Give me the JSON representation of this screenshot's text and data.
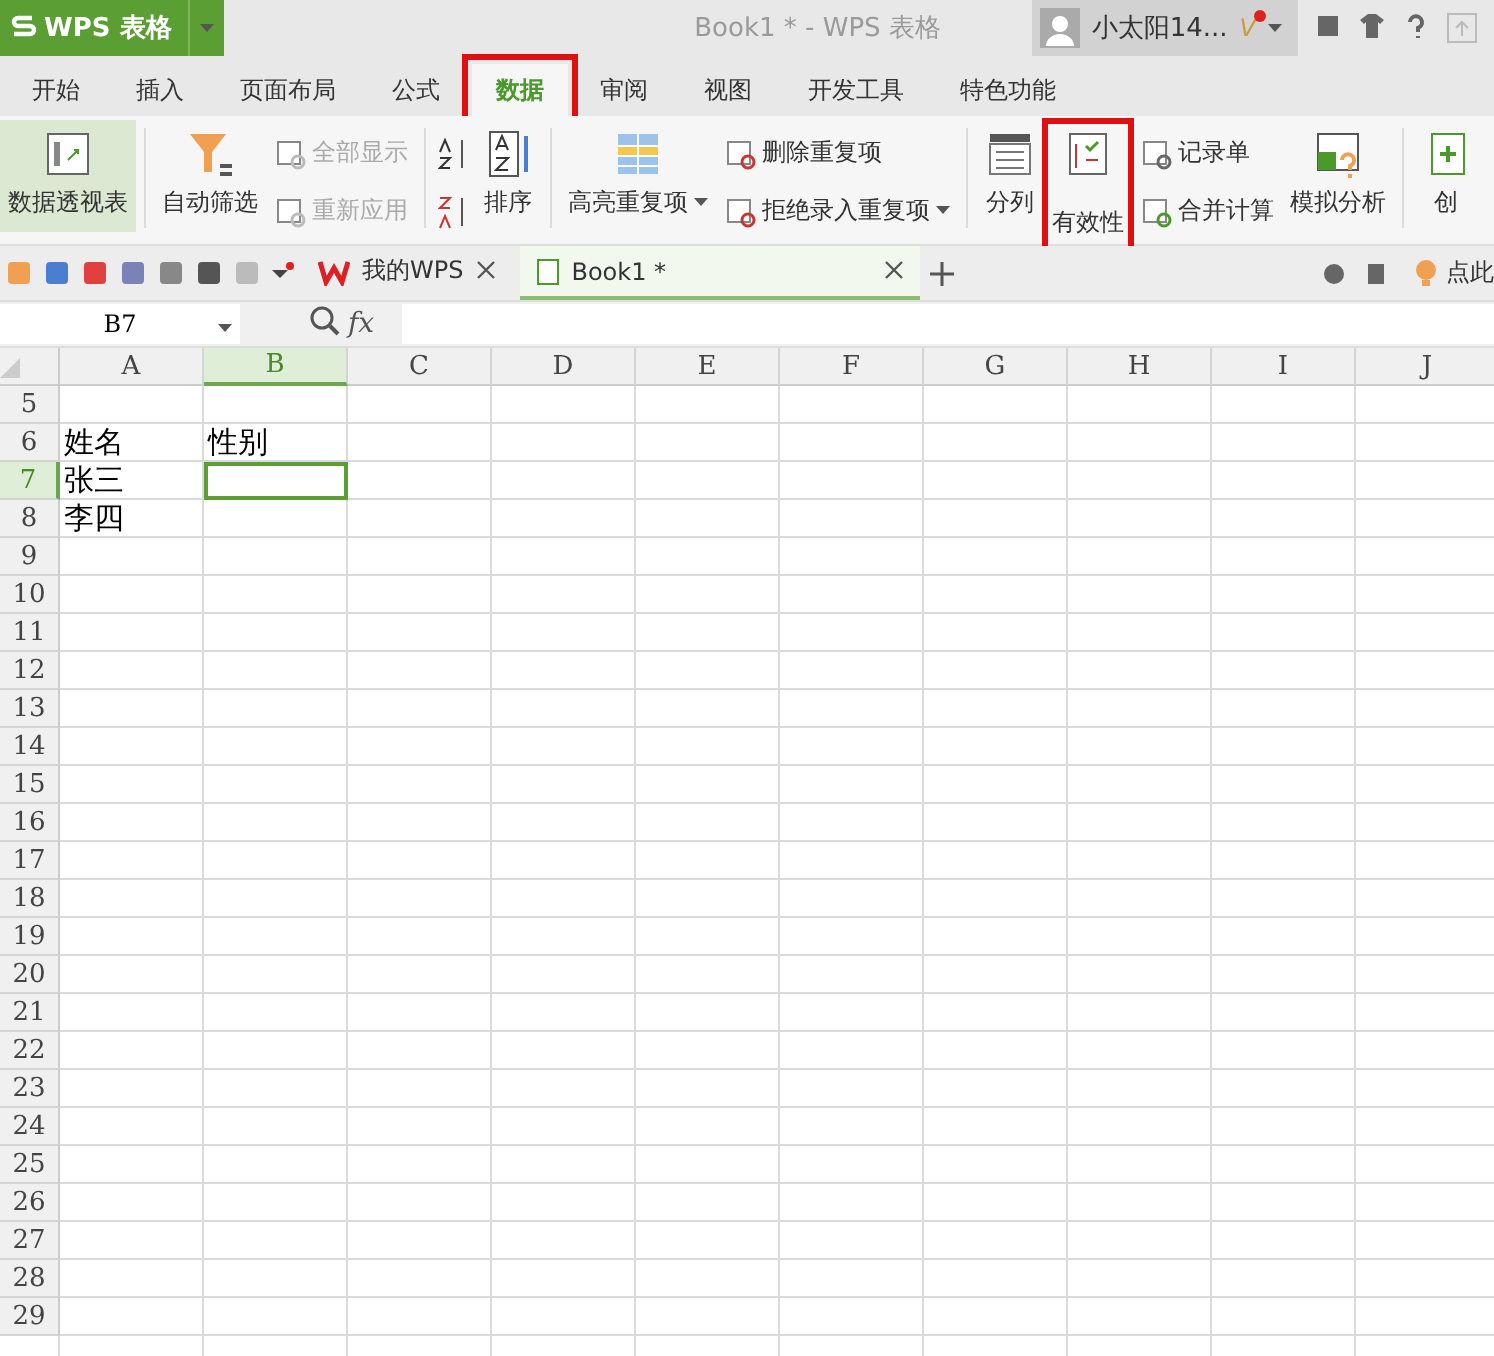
{
  "app_menu": {
    "label": "WPS 表格"
  },
  "title": "Book1 * - WPS 表格",
  "user": {
    "name": "小太阳14...",
    "badge": "V"
  },
  "tabs": [
    {
      "label": "开始",
      "selected": false,
      "highlighted": false
    },
    {
      "label": "插入",
      "selected": false,
      "highlighted": false
    },
    {
      "label": "页面布局",
      "selected": false,
      "highlighted": false
    },
    {
      "label": "公式",
      "selected": false,
      "highlighted": false
    },
    {
      "label": "数据",
      "selected": true,
      "highlighted": true
    },
    {
      "label": "审阅",
      "selected": false,
      "highlighted": false
    },
    {
      "label": "视图",
      "selected": false,
      "highlighted": false
    },
    {
      "label": "开发工具",
      "selected": false,
      "highlighted": false
    },
    {
      "label": "特色功能",
      "selected": false,
      "highlighted": false
    }
  ],
  "ribbon": [
    {
      "kind": "large",
      "label": "数据透视表",
      "pressed": true,
      "highlighted": false,
      "dropdown": false
    },
    {
      "kind": "sep"
    },
    {
      "kind": "large",
      "label": "自动筛选",
      "pressed": false,
      "highlighted": false,
      "dropdown": false
    },
    {
      "kind": "stack",
      "items": [
        {
          "label": "全部显示",
          "disabled": true,
          "dropdown": false
        },
        {
          "label": "重新应用",
          "disabled": true,
          "dropdown": false
        }
      ]
    },
    {
      "kind": "sep"
    },
    {
      "kind": "sort"
    },
    {
      "kind": "large",
      "label": "排序",
      "pressed": false,
      "highlighted": false,
      "dropdown": false
    },
    {
      "kind": "sep"
    },
    {
      "kind": "large",
      "label": "高亮重复项",
      "pressed": false,
      "highlighted": false,
      "dropdown": true
    },
    {
      "kind": "stack",
      "items": [
        {
          "label": "删除重复项",
          "disabled": false,
          "dropdown": false
        },
        {
          "label": "拒绝录入重复项",
          "disabled": false,
          "dropdown": true
        }
      ]
    },
    {
      "kind": "sep"
    },
    {
      "kind": "large",
      "label": "分列",
      "pressed": false,
      "highlighted": false,
      "dropdown": false
    },
    {
      "kind": "large",
      "label": "有效性",
      "pressed": false,
      "highlighted": true,
      "dropdown": false
    },
    {
      "kind": "stack",
      "items": [
        {
          "label": "记录单",
          "disabled": false,
          "dropdown": false
        },
        {
          "label": "合并计算",
          "disabled": false,
          "dropdown": false
        }
      ]
    },
    {
      "kind": "large",
      "label": "模拟分析",
      "pressed": false,
      "highlighted": false,
      "dropdown": false
    },
    {
      "kind": "sep"
    },
    {
      "kind": "large",
      "label": "创",
      "pressed": false,
      "highlighted": false,
      "dropdown": false
    }
  ],
  "doc_tabs": [
    {
      "label": "我的WPS",
      "selected": false
    },
    {
      "label": "Book1 *",
      "selected": true
    }
  ],
  "tip": "点此",
  "name_box": "B7",
  "function_label": "fx",
  "columns": [
    {
      "label": "A",
      "selected": false
    },
    {
      "label": "B",
      "selected": true
    },
    {
      "label": "C",
      "selected": false
    },
    {
      "label": "D",
      "selected": false
    },
    {
      "label": "E",
      "selected": false
    },
    {
      "label": "F",
      "selected": false
    },
    {
      "label": "G",
      "selected": false
    },
    {
      "label": "H",
      "selected": false
    },
    {
      "label": "I",
      "selected": false
    },
    {
      "label": "J",
      "selected": false
    }
  ],
  "rows": [
    {
      "number": "5",
      "selected": false
    },
    {
      "number": "6",
      "selected": false,
      "cells": {
        "A": "姓名",
        "B": "性别"
      }
    },
    {
      "number": "7",
      "selected": true,
      "cells": {
        "A": "张三"
      }
    },
    {
      "number": "8",
      "selected": false,
      "cells": {
        "A": "李四"
      }
    },
    {
      "number": "9",
      "selected": false
    },
    {
      "number": "10",
      "selected": false
    },
    {
      "number": "11",
      "selected": false
    },
    {
      "number": "12",
      "selected": false
    },
    {
      "number": "13",
      "selected": false
    },
    {
      "number": "14",
      "selected": false
    },
    {
      "number": "15",
      "selected": false
    },
    {
      "number": "16",
      "selected": false
    },
    {
      "number": "17",
      "selected": false
    },
    {
      "number": "18",
      "selected": false
    },
    {
      "number": "19",
      "selected": false
    },
    {
      "number": "20",
      "selected": false
    },
    {
      "number": "21",
      "selected": false
    },
    {
      "number": "22",
      "selected": false
    },
    {
      "number": "23",
      "selected": false
    },
    {
      "number": "24",
      "selected": false
    },
    {
      "number": "25",
      "selected": false
    },
    {
      "number": "26",
      "selected": false
    },
    {
      "number": "27",
      "selected": false
    },
    {
      "number": "28",
      "selected": false
    },
    {
      "number": "29",
      "selected": false
    }
  ]
}
